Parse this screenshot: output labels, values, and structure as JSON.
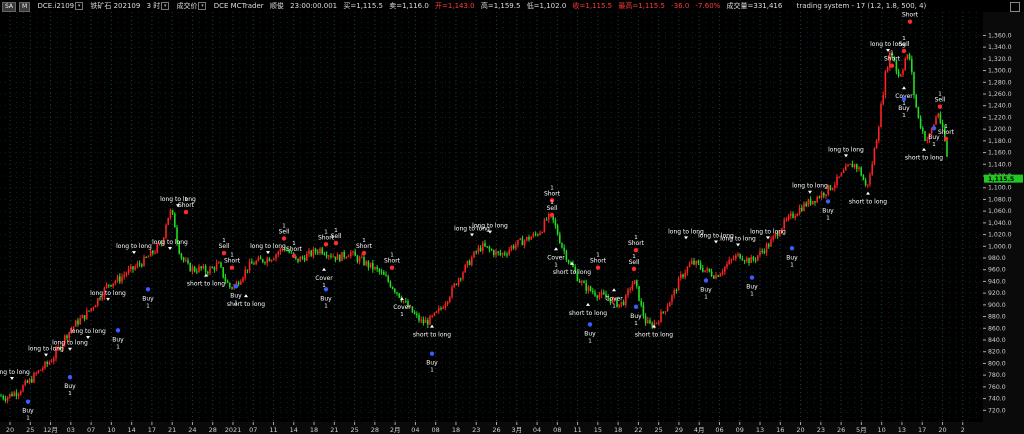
{
  "header": {
    "symbol_btn": "SA",
    "mode_btn": "M",
    "contract": "DCE.i2109",
    "name": "铁矿石 202109",
    "bar_type": "3 时",
    "tab_label": "成交价",
    "broker": "DCE",
    "broker_app": "MCTrader",
    "quote_label": "顺俊",
    "time": "23:00:00.001",
    "bid": "买=1,115.5",
    "ask": "卖=1,116.0",
    "open": "开=1,143.0",
    "high": "高=1,159.5",
    "low": "低=1,102.0",
    "close": "收=1,115.5",
    "change": "最高=1,115.5",
    "change_abs": "-36.0",
    "change_pct": "-7.60%",
    "volume": "成交量=331,416",
    "system": "trading system - 17 (1.2,  1.8,  500,  4)"
  },
  "chart_data": {
    "type": "candlestick",
    "ylim": [
      700,
      1400
    ],
    "y_ticks": [
      "720.0",
      "740.0",
      "760.0",
      "780.0",
      "800.0",
      "820.0",
      "840.0",
      "860.0",
      "880.0",
      "900.0",
      "920.0",
      "940.0",
      "960.0",
      "980.0",
      "1,000.0",
      "1,020.0",
      "1,040.0",
      "1,060.0",
      "1,080.0",
      "1,100.0",
      "1,120.0",
      "1,140.0",
      "1,160.0",
      "1,180.0",
      "1,200.0",
      "1,220.0",
      "1,240.0",
      "1,260.0",
      "1,280.0",
      "1,300.0",
      "1,320.0",
      "1,340.0",
      "1,360.0"
    ],
    "last_price_label": "1,115.5",
    "last_price": 1115.5,
    "x_ticks": [
      "20",
      "25",
      "12月",
      "03",
      "07",
      "10",
      "14",
      "17",
      "21",
      "24",
      "28",
      "2021",
      "07",
      "11",
      "14",
      "18",
      "21",
      "25",
      "28",
      "2月",
      "04",
      "08",
      "18",
      "23",
      "26",
      "3月",
      "04",
      "08",
      "11",
      "15",
      "18",
      "22",
      "25",
      "29",
      "4月",
      "06",
      "09",
      "13",
      "16",
      "20",
      "23",
      "26",
      "5月",
      "10",
      "13",
      "17",
      "20",
      "2"
    ],
    "price_path": [
      [
        0,
        745
      ],
      [
        6,
        742
      ],
      [
        12,
        748
      ],
      [
        18,
        752
      ],
      [
        24,
        762
      ],
      [
        30,
        770
      ],
      [
        36,
        782
      ],
      [
        42,
        792
      ],
      [
        48,
        800
      ],
      [
        54,
        812
      ],
      [
        60,
        830
      ],
      [
        66,
        848
      ],
      [
        72,
        860
      ],
      [
        78,
        872
      ],
      [
        84,
        880
      ],
      [
        90,
        892
      ],
      [
        96,
        905
      ],
      [
        102,
        920
      ],
      [
        108,
        935
      ],
      [
        114,
        940
      ],
      [
        120,
        945
      ],
      [
        126,
        955
      ],
      [
        132,
        960
      ],
      [
        138,
        968
      ],
      [
        144,
        975
      ],
      [
        150,
        985
      ],
      [
        156,
        995
      ],
      [
        162,
        1005
      ],
      [
        166,
        1040
      ],
      [
        170,
        1060
      ],
      [
        174,
        1045
      ],
      [
        178,
        1000
      ],
      [
        182,
        980
      ],
      [
        188,
        965
      ],
      [
        194,
        960
      ],
      [
        200,
        962
      ],
      [
        206,
        958
      ],
      [
        212,
        962
      ],
      [
        218,
        970
      ],
      [
        222,
        955
      ],
      [
        226,
        940
      ],
      [
        230,
        930
      ],
      [
        236,
        935
      ],
      [
        242,
        950
      ],
      [
        248,
        965
      ],
      [
        254,
        972
      ],
      [
        260,
        975
      ],
      [
        266,
        978
      ],
      [
        272,
        982
      ],
      [
        278,
        990
      ],
      [
        284,
        998
      ],
      [
        290,
        988
      ],
      [
        296,
        975
      ],
      [
        302,
        980
      ],
      [
        308,
        985
      ],
      [
        314,
        990
      ],
      [
        320,
        995
      ],
      [
        326,
        990
      ],
      [
        332,
        985
      ],
      [
        338,
        980
      ],
      [
        344,
        985
      ],
      [
        350,
        990
      ],
      [
        356,
        980
      ],
      [
        362,
        975
      ],
      [
        368,
        968
      ],
      [
        374,
        962
      ],
      [
        380,
        955
      ],
      [
        386,
        945
      ],
      [
        392,
        932
      ],
      [
        398,
        920
      ],
      [
        404,
        905
      ],
      [
        410,
        892
      ],
      [
        416,
        880
      ],
      [
        422,
        870
      ],
      [
        428,
        872
      ],
      [
        434,
        880
      ],
      [
        440,
        892
      ],
      [
        446,
        908
      ],
      [
        452,
        925
      ],
      [
        458,
        945
      ],
      [
        464,
        960
      ],
      [
        470,
        975
      ],
      [
        476,
        990
      ],
      [
        482,
        1000
      ],
      [
        488,
        995
      ],
      [
        494,
        990
      ],
      [
        500,
        985
      ],
      [
        506,
        990
      ],
      [
        512,
        1000
      ],
      [
        518,
        1005
      ],
      [
        524,
        1010
      ],
      [
        530,
        1015
      ],
      [
        536,
        1020
      ],
      [
        542,
        1030
      ],
      [
        546,
        1045
      ],
      [
        550,
        1050
      ],
      [
        554,
        1040
      ],
      [
        558,
        1020
      ],
      [
        562,
        1000
      ],
      [
        566,
        985
      ],
      [
        570,
        970
      ],
      [
        574,
        960
      ],
      [
        578,
        945
      ],
      [
        584,
        932
      ],
      [
        590,
        925
      ],
      [
        596,
        920
      ],
      [
        602,
        915
      ],
      [
        608,
        912
      ],
      [
        614,
        905
      ],
      [
        620,
        900
      ],
      [
        626,
        910
      ],
      [
        630,
        930
      ],
      [
        634,
        940
      ],
      [
        638,
        920
      ],
      [
        642,
        890
      ],
      [
        646,
        870
      ],
      [
        650,
        865
      ],
      [
        656,
        870
      ],
      [
        662,
        885
      ],
      [
        668,
        902
      ],
      [
        674,
        920
      ],
      [
        680,
        945
      ],
      [
        686,
        960
      ],
      [
        692,
        972
      ],
      [
        698,
        968
      ],
      [
        704,
        960
      ],
      [
        710,
        955
      ],
      [
        716,
        950
      ],
      [
        722,
        960
      ],
      [
        728,
        970
      ],
      [
        734,
        980
      ],
      [
        740,
        985
      ],
      [
        746,
        978
      ],
      [
        752,
        975
      ],
      [
        758,
        985
      ],
      [
        764,
        995
      ],
      [
        770,
        1005
      ],
      [
        776,
        1020
      ],
      [
        782,
        1035
      ],
      [
        788,
        1045
      ],
      [
        794,
        1055
      ],
      [
        800,
        1065
      ],
      [
        806,
        1072
      ],
      [
        812,
        1078
      ],
      [
        818,
        1085
      ],
      [
        824,
        1092
      ],
      [
        830,
        1100
      ],
      [
        836,
        1110
      ],
      [
        842,
        1122
      ],
      [
        848,
        1135
      ],
      [
        854,
        1140
      ],
      [
        860,
        1130
      ],
      [
        866,
        1100
      ],
      [
        870,
        1120
      ],
      [
        874,
        1160
      ],
      [
        878,
        1200
      ],
      [
        882,
        1250
      ],
      [
        886,
        1300
      ],
      [
        890,
        1330
      ],
      [
        894,
        1320
      ],
      [
        898,
        1290
      ],
      [
        902,
        1300
      ],
      [
        906,
        1325
      ],
      [
        910,
        1320
      ],
      [
        914,
        1260
      ],
      [
        918,
        1220
      ],
      [
        922,
        1200
      ],
      [
        926,
        1180
      ],
      [
        930,
        1190
      ],
      [
        934,
        1210
      ],
      [
        938,
        1230
      ],
      [
        942,
        1200
      ],
      [
        946,
        1170
      ],
      [
        949,
        1115
      ]
    ],
    "annotations": [
      {
        "label": "long to long",
        "x": 12,
        "y": 770,
        "side": "above",
        "color": "#ffffff"
      },
      {
        "label": "Buy",
        "x": 28,
        "y": 738,
        "side": "below",
        "color": "#3a5bff",
        "qty": "1"
      },
      {
        "label": "long to long",
        "x": 46,
        "y": 810,
        "side": "above",
        "color": "#ffffff"
      },
      {
        "label": "long to long",
        "x": 70,
        "y": 820,
        "side": "above",
        "color": "#ffffff"
      },
      {
        "label": "long to long",
        "x": 88,
        "y": 840,
        "side": "above",
        "color": "#ffffff"
      },
      {
        "label": "Buy",
        "x": 70,
        "y": 780,
        "side": "below",
        "color": "#3a5bff",
        "qty": "1"
      },
      {
        "label": "long to long",
        "x": 108,
        "y": 905,
        "side": "above",
        "color": "#ffffff"
      },
      {
        "label": "Buy",
        "x": 118,
        "y": 860,
        "side": "below",
        "color": "#3a5bff",
        "qty": "1"
      },
      {
        "label": "long to long",
        "x": 134,
        "y": 985,
        "side": "above",
        "color": "#ffffff"
      },
      {
        "label": "Buy",
        "x": 148,
        "y": 930,
        "side": "below",
        "color": "#3a5bff",
        "qty": "1"
      },
      {
        "label": "long to long",
        "x": 178,
        "y": 1065,
        "side": "above",
        "color": "#ffffff"
      },
      {
        "label": "Short",
        "x": 186,
        "y": 1055,
        "side": "above",
        "color": "#ff2a2a",
        "qty": "1"
      },
      {
        "label": "long to long",
        "x": 170,
        "y": 992,
        "side": "above",
        "color": "#ffffff"
      },
      {
        "label": "short to long",
        "x": 206,
        "y": 955,
        "side": "below",
        "color": "#ffffff"
      },
      {
        "label": "Sell",
        "x": 224,
        "y": 985,
        "side": "above",
        "color": "#ff2a2a",
        "qty": "1"
      },
      {
        "label": "Short",
        "x": 232,
        "y": 960,
        "side": "above",
        "color": "#ff2a2a",
        "qty": "1"
      },
      {
        "label": "Buy",
        "x": 236,
        "y": 935,
        "side": "below",
        "color": "#3a5bff",
        "qty": "1"
      },
      {
        "label": "short to long",
        "x": 246,
        "y": 920,
        "side": "below",
        "color": "#ffffff"
      },
      {
        "label": "long to long",
        "x": 268,
        "y": 985,
        "side": "above",
        "color": "#ffffff"
      },
      {
        "label": "Sell",
        "x": 284,
        "y": 1010,
        "side": "above",
        "color": "#ff2a2a",
        "qty": "1"
      },
      {
        "label": "Short",
        "x": 294,
        "y": 980,
        "side": "above",
        "color": "#ff2a2a",
        "qty": "1"
      },
      {
        "label": "Short",
        "x": 326,
        "y": 1000,
        "side": "above",
        "color": "#ff2a2a",
        "qty": "1"
      },
      {
        "label": "Cover",
        "x": 324,
        "y": 965,
        "side": "below",
        "color": "#ffffff",
        "qty": "1"
      },
      {
        "label": "Buy",
        "x": 326,
        "y": 930,
        "side": "below",
        "color": "#3a5bff",
        "qty": "1"
      },
      {
        "label": "Sell",
        "x": 336,
        "y": 1002,
        "side": "above",
        "color": "#ff2a2a",
        "qty": "1"
      },
      {
        "label": "Short",
        "x": 364,
        "y": 985,
        "side": "above",
        "color": "#ff2a2a",
        "qty": "1"
      },
      {
        "label": "Short",
        "x": 392,
        "y": 960,
        "side": "above",
        "color": "#ff2a2a",
        "qty": "1"
      },
      {
        "label": "Cover",
        "x": 402,
        "y": 915,
        "side": "below",
        "color": "#ffffff",
        "qty": "1"
      },
      {
        "label": "short to long",
        "x": 432,
        "y": 868,
        "side": "below",
        "color": "#ffffff"
      },
      {
        "label": "Buy",
        "x": 432,
        "y": 820,
        "side": "below",
        "color": "#3a5bff",
        "qty": "1"
      },
      {
        "label": "long to long",
        "x": 472,
        "y": 1015,
        "side": "above",
        "color": "#ffffff"
      },
      {
        "label": "long to long",
        "x": 490,
        "y": 1020,
        "side": "above",
        "color": "#ffffff"
      },
      {
        "label": "Short",
        "x": 552,
        "y": 1075,
        "side": "above",
        "color": "#ff2a2a",
        "qty": "1"
      },
      {
        "label": "Sell",
        "x": 552,
        "y": 1050,
        "side": "above",
        "color": "#ff2a2a",
        "qty": "1"
      },
      {
        "label": "Cover",
        "x": 556,
        "y": 1000,
        "side": "below",
        "color": "#ffffff",
        "qty": "1"
      },
      {
        "label": "short to long",
        "x": 572,
        "y": 975,
        "side": "below",
        "color": "#ffffff"
      },
      {
        "label": "Short",
        "x": 598,
        "y": 960,
        "side": "above",
        "color": "#ff2a2a",
        "qty": "1"
      },
      {
        "label": "short to long",
        "x": 588,
        "y": 905,
        "side": "below",
        "color": "#ffffff"
      },
      {
        "label": "Buy",
        "x": 590,
        "y": 870,
        "side": "below",
        "color": "#3a5bff",
        "qty": "1"
      },
      {
        "label": "Cover",
        "x": 614,
        "y": 930,
        "side": "below",
        "color": "#ffffff",
        "qty": "1"
      },
      {
        "label": "Short",
        "x": 636,
        "y": 990,
        "side": "above",
        "color": "#ff2a2a",
        "qty": "1"
      },
      {
        "label": "Sell",
        "x": 634,
        "y": 958,
        "side": "above",
        "color": "#ff2a2a",
        "qty": "1"
      },
      {
        "label": "Buy",
        "x": 636,
        "y": 900,
        "side": "below",
        "color": "#3a5bff",
        "qty": "1"
      },
      {
        "label": "short to long",
        "x": 654,
        "y": 868,
        "side": "below",
        "color": "#ffffff"
      },
      {
        "label": "long to long",
        "x": 686,
        "y": 1010,
        "side": "above",
        "color": "#ffffff"
      },
      {
        "label": "Buy",
        "x": 706,
        "y": 945,
        "side": "below",
        "color": "#3a5bff",
        "qty": "1"
      },
      {
        "label": "long to long",
        "x": 716,
        "y": 1003,
        "side": "above",
        "color": "#ffffff"
      },
      {
        "label": "long to long",
        "x": 738,
        "y": 998,
        "side": "above",
        "color": "#ffffff"
      },
      {
        "label": "Buy",
        "x": 752,
        "y": 950,
        "side": "below",
        "color": "#3a5bff",
        "qty": "1"
      },
      {
        "label": "long to long",
        "x": 768,
        "y": 1010,
        "side": "above",
        "color": "#ffffff"
      },
      {
        "label": "Buy",
        "x": 792,
        "y": 1000,
        "side": "below",
        "color": "#3a5bff",
        "qty": "1"
      },
      {
        "label": "long to long",
        "x": 810,
        "y": 1088,
        "side": "above",
        "color": "#ffffff"
      },
      {
        "label": "Buy",
        "x": 828,
        "y": 1080,
        "side": "below",
        "color": "#3a5bff",
        "qty": "1"
      },
      {
        "label": "long to long",
        "x": 846,
        "y": 1150,
        "side": "above",
        "color": "#ffffff"
      },
      {
        "label": "short to long",
        "x": 868,
        "y": 1095,
        "side": "below",
        "color": "#ffffff"
      },
      {
        "label": "long to long",
        "x": 888,
        "y": 1330,
        "side": "above",
        "color": "#ffffff"
      },
      {
        "label": "Short",
        "x": 910,
        "y": 1380,
        "side": "above",
        "color": "#ff2a2a",
        "qty": "1"
      },
      {
        "label": "Sell",
        "x": 904,
        "y": 1330,
        "side": "above",
        "color": "#ff2a2a",
        "qty": "1"
      },
      {
        "label": "Short",
        "x": 892,
        "y": 1305,
        "side": "above",
        "color": "#ff2a2a",
        "qty": "1"
      },
      {
        "label": "Cover",
        "x": 904,
        "y": 1275,
        "side": "below",
        "color": "#ffffff",
        "qty": "1"
      },
      {
        "label": "Buy",
        "x": 904,
        "y": 1255,
        "side": "below",
        "color": "#3a5bff",
        "qty": "1"
      },
      {
        "label": "Sell",
        "x": 940,
        "y": 1235,
        "side": "above",
        "color": "#ff2a2a",
        "qty": "1"
      },
      {
        "label": "Short",
        "x": 946,
        "y": 1180,
        "side": "above",
        "color": "#ff2a2a",
        "qty": "1"
      },
      {
        "label": "short to long",
        "x": 924,
        "y": 1170,
        "side": "below",
        "color": "#ffffff"
      },
      {
        "label": "Buy",
        "x": 934,
        "y": 1205,
        "side": "below",
        "color": "#3a5bff",
        "qty": "1"
      }
    ],
    "colors": {
      "up": "#ff2222",
      "down": "#22dd22",
      "grid": "#0a4a4a",
      "axis_text": "#cfcfcf",
      "last_price_bg": "#22c822"
    }
  }
}
